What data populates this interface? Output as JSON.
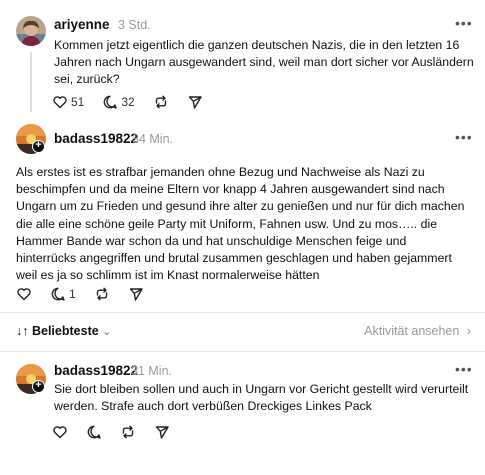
{
  "posts": [
    {
      "username": "ariyenne",
      "time": "3 Std.",
      "text": "Kommen jetzt eigentlich die ganzen deutschen Nazis, die in den letzten 16 Jahren nach Ungarn ausgewandert sind, weil man dort sicher vor Ausländern sei, zurück?",
      "likes": "51",
      "replies": "32"
    },
    {
      "username": "badass19822",
      "time": "34 Min.",
      "text": "Als erstes ist es strafbar jemanden ohne Bezug und Nachweise als Nazi zu beschimpfen und da meine Eltern vor knapp 4 Jahren ausgewandert sind nach Ungarn um zu Frieden und gesund ihre alter zu genießen und nur für dich machen die alle eine schöne geile Party mit Uniform, Fahnen usw. Und zu mos….. die Hammer Bande war schon da und hat unschuldige Menschen feige und hinterrücks angegriffen und brutal zusammen geschlagen und haben gejammert weil es ja so schlimm ist im Knast normalerweise hätten",
      "replies": "1"
    },
    {
      "username": "badass19822",
      "time": "31 Min.",
      "text": "Sie dort bleiben sollen und auch in Ungarn vor Gericht gestellt wird verurteilt werden. Strafe auch dort verbüßen Dreckiges Linkes Pack"
    }
  ],
  "sort": {
    "label": "Beliebteste",
    "activity_label": "Aktivität ansehen"
  },
  "colors": {
    "text": "#101010",
    "muted": "#9a9a9a",
    "divider": "#e5e5e5"
  }
}
